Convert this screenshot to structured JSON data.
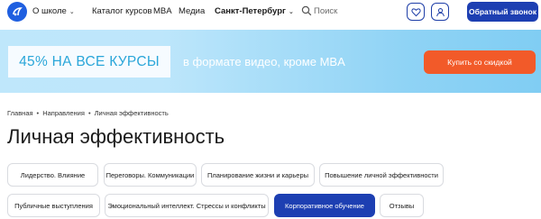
{
  "header": {
    "nav": [
      {
        "label": "О школе",
        "has_dropdown": true
      },
      {
        "label": "Каталог курсов",
        "has_dropdown": false
      },
      {
        "label": "MBA",
        "has_dropdown": false
      },
      {
        "label": "Медиа",
        "has_dropdown": false
      },
      {
        "label": "Санкт-Петербург",
        "has_dropdown": true
      }
    ],
    "search": {
      "placeholder": "Поиск"
    },
    "callback_label": "Обратный звонок"
  },
  "banner": {
    "promo": "45% НА ВСЕ КУРСЫ",
    "subtitle": "в формате видео, кроме MBA",
    "cta_label": "Купить со скидкой"
  },
  "breadcrumb": [
    "Главная",
    "Направления",
    "Личная эффективность"
  ],
  "page_title": "Личная эффективность",
  "chips": [
    {
      "label": "Лидерство. Влияние",
      "active": false
    },
    {
      "label": "Переговоры. Коммуникации",
      "active": false
    },
    {
      "label": "Планирование жизни и карьеры",
      "active": false
    },
    {
      "label": "Повышение личной эффективности",
      "active": false
    },
    {
      "label": "Публичные выступления",
      "active": false
    },
    {
      "label": "Эмоциональный интеллект. Стрессы и конфликты",
      "active": false
    },
    {
      "label": "Корпоративное обучение",
      "active": true
    },
    {
      "label": "Отзывы",
      "active": false
    }
  ],
  "colors": {
    "brand": "#1d3fb2",
    "cta": "#f25a29",
    "promo_text": "#2aa6d9"
  }
}
